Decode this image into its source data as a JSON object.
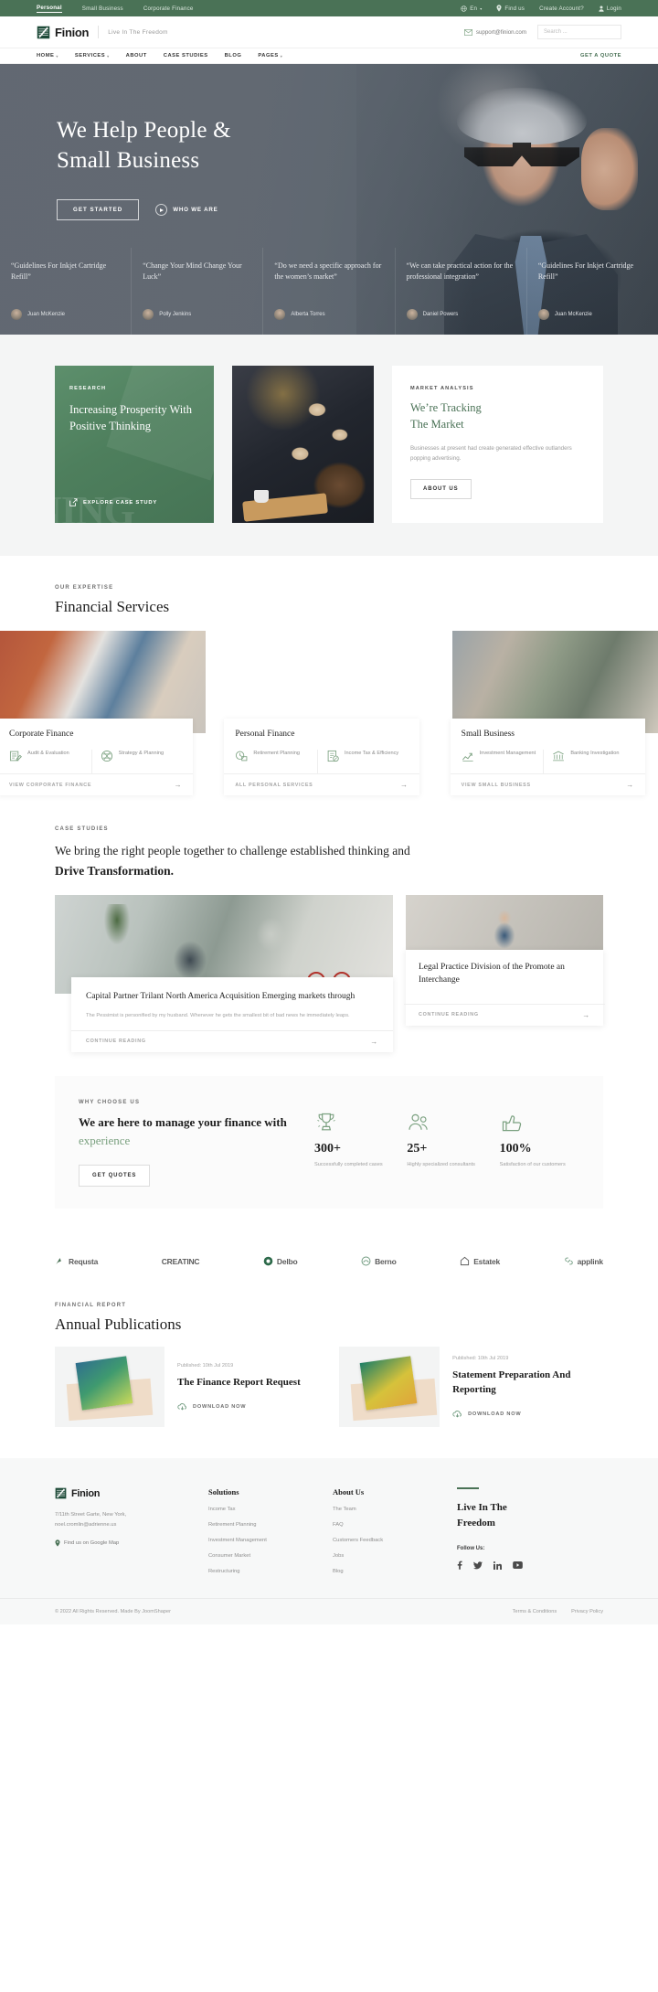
{
  "topbar": {
    "left_items": [
      {
        "label": "Personal",
        "active": true
      },
      {
        "label": "Small Business",
        "active": false
      },
      {
        "label": "Corporate Finance",
        "active": false
      }
    ],
    "lang": "En",
    "find_us": "Find us",
    "create_account": "Create Account?",
    "login": "Login",
    "bg_color": "#4a7256"
  },
  "header": {
    "brand": "Finion",
    "tagline": "Live In The Freedom",
    "email": "support@finion.com",
    "search_placeholder": "Search ..."
  },
  "nav": {
    "items": [
      {
        "label": "HOME",
        "caret": true
      },
      {
        "label": "SERVICES",
        "caret": true
      },
      {
        "label": "ABOUT",
        "caret": false
      },
      {
        "label": "CASE STUDIES",
        "caret": false
      },
      {
        "label": "BLOG",
        "caret": false
      },
      {
        "label": "PAGES",
        "caret": true
      }
    ],
    "quote": "GET A QUOTE"
  },
  "hero": {
    "title_line1": "We Help People &",
    "title_line2": "Small Business",
    "cta_primary": "GET STARTED",
    "cta_secondary": "WHO WE ARE",
    "testimonials": [
      {
        "quote": "“Guidelines For Inkjet Cartridge Refill”",
        "name": "Juan McKenzie"
      },
      {
        "quote": "“Change Your Mind Change Your Luck”",
        "name": "Polly Jenkins"
      },
      {
        "quote": "“Do we need a specific approach for the women’s market”",
        "name": "Alberta Torres"
      },
      {
        "quote": "“We can take practical action for the professional integration”",
        "name": "Daniel Powers"
      },
      {
        "quote": "“Guidelines For Inkjet Cartridge Refill”",
        "name": "Juan McKenzie"
      }
    ]
  },
  "research": {
    "kicker": "RESEARCH",
    "title": "Increasing Prosperity With Positive Thinking",
    "link": "EXPLORE CASE STUDY",
    "ghost_text": "NING",
    "bg_color": "#4e7f5d"
  },
  "market": {
    "kicker": "MARKET ANALYSIS",
    "title_line1": "We’re Tracking",
    "title_line2": "The Market",
    "body": "Businesses at present had create generated effective outlanders popping advertising.",
    "button": "ABOUT US",
    "accent_color": "#4a7256"
  },
  "expertise": {
    "kicker": "OUR EXPERTISE",
    "heading": "Financial Services",
    "cards": [
      {
        "title": "Corporate Finance",
        "features": [
          {
            "icon": "audit-icon",
            "label": "Audit & Evaluation"
          },
          {
            "icon": "strategy-icon",
            "label": "Strategy & Planning"
          }
        ],
        "footer": "VIEW CORPORATE FINANCE"
      },
      {
        "title": "Personal Finance",
        "features": [
          {
            "icon": "retirement-icon",
            "label": "Retirement Planning"
          },
          {
            "icon": "tax-icon",
            "label": "Income Tax & Efficiency"
          }
        ],
        "footer": "ALL PERSONAL SERVICES"
      },
      {
        "title": "Small Business",
        "features": [
          {
            "icon": "investment-icon",
            "label": "Investment Management"
          },
          {
            "icon": "banking-icon",
            "label": "Banking Investigation"
          }
        ],
        "footer": "VIEW SMALL BUSINESS"
      }
    ]
  },
  "case_studies": {
    "kicker": "CASE STUDIES",
    "heading_plain": "We bring the right people together to challenge established thinking and ",
    "heading_bold": "Drive Transformation.",
    "main": {
      "title": "Capital Partner Trilant North America Acquisition Emerging markets through",
      "text": "The Pessimist is personified by my husband. Whenever he gets the smallest bit of bad news he immediately leaps.",
      "link": "CONTINUE READING"
    },
    "side": {
      "title": "Legal Practice Division of the Promote an Interchange",
      "link": "CONTINUE READING"
    }
  },
  "why": {
    "kicker": "WHY CHOOSE US",
    "heading_plain": "We are here to manage your finance with ",
    "heading_accent": "experience",
    "button": "GET QUOTES",
    "stats": [
      {
        "icon": "trophy-icon",
        "number": "300+",
        "label": "Successfully completed cases"
      },
      {
        "icon": "team-icon",
        "number": "25+",
        "label": "Highly specialized consultants"
      },
      {
        "icon": "satisfaction-icon",
        "number": "100%",
        "label": "Satisfaction of our customers"
      }
    ]
  },
  "logos": [
    {
      "name": "Requsta",
      "icon": "requsta-icon"
    },
    {
      "name": "CREATINC",
      "icon": "createinc-icon"
    },
    {
      "name": "Delbo",
      "icon": "delbo-icon"
    },
    {
      "name": "Berno",
      "icon": "berno-icon"
    },
    {
      "name": "Estatek",
      "icon": "estatek-icon"
    },
    {
      "name": "applink",
      "icon": "applink-icon"
    }
  ],
  "report": {
    "kicker": "FINANCIAL REPORT",
    "heading": "Annual Publications",
    "items": [
      {
        "published": "Published: 10th Jul 2019",
        "title": "The Finance Report Request",
        "download": "DOWNLOAD NOW",
        "thumb": "analysis-book"
      },
      {
        "published": "Published: 10th Jul 2019",
        "title": "Statement Preparation And Reporting",
        "download": "DOWNLOAD NOW",
        "thumb": "gold-investment-book"
      }
    ]
  },
  "footer": {
    "brand": "Finion",
    "address_line1": "7/11th Street Garte, New York,",
    "address_line2": "noel.cromlin@adrienne.us",
    "map_link": "Find us on Google Map",
    "columns": [
      {
        "heading": "Solutions",
        "items": [
          "Income Tax",
          "Retirement Planning",
          "Investment Management",
          "Consumer Market",
          "Restructuring"
        ]
      },
      {
        "heading": "About Us",
        "items": [
          "The Team",
          "FAQ",
          "Customers Feedback",
          "Jobs",
          "Blog"
        ]
      }
    ],
    "slogan_line1": "Live In The",
    "slogan_line2": "Freedom",
    "follow_label": "Follow Us:",
    "socials": [
      "facebook-icon",
      "twitter-icon",
      "linkedin-icon",
      "youtube-icon"
    ],
    "copyright": "© 2022 All Rights Reserved. Made By JoomShaper",
    "legal": [
      "Terms & Conditions",
      "Privacy Policy"
    ]
  }
}
